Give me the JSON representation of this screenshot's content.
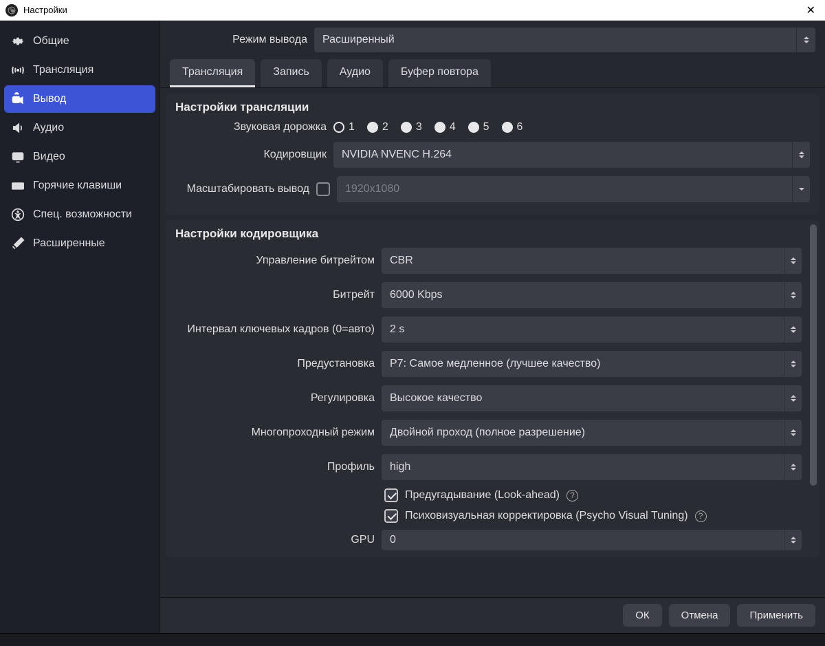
{
  "window": {
    "title": "Настройки"
  },
  "sidebar": {
    "items": [
      {
        "label": "Общие"
      },
      {
        "label": "Трансляция"
      },
      {
        "label": "Вывод"
      },
      {
        "label": "Аудио"
      },
      {
        "label": "Видео"
      },
      {
        "label": "Горячие клавиши"
      },
      {
        "label": "Спец. возможности"
      },
      {
        "label": "Расширенные"
      }
    ]
  },
  "output_mode": {
    "label": "Режим вывода",
    "value": "Расширенный"
  },
  "tabs": [
    {
      "label": "Трансляция"
    },
    {
      "label": "Запись"
    },
    {
      "label": "Аудио"
    },
    {
      "label": "Буфер повтора"
    }
  ],
  "stream": {
    "title": "Настройки трансляции",
    "audio_track_label": "Звуковая дорожка",
    "tracks": [
      "1",
      "2",
      "3",
      "4",
      "5",
      "6"
    ],
    "encoder_label": "Кодировщик",
    "encoder_value": "NVIDIA NVENC H.264",
    "rescale_label": "Масштабировать вывод",
    "rescale_value": "1920x1080"
  },
  "encoder": {
    "title": "Настройки кодировщика",
    "rate_control_label": "Управление битрейтом",
    "rate_control_value": "CBR",
    "bitrate_label": "Битрейт",
    "bitrate_value": "6000 Kbps",
    "keyint_label": "Интервал ключевых кадров (0=авто)",
    "keyint_value": "2 s",
    "preset_label": "Предустановка",
    "preset_value": "P7: Самое медленное (лучшее качество)",
    "tuning_label": "Регулировка",
    "tuning_value": "Высокое качество",
    "multipass_label": "Многопроходный режим",
    "multipass_value": "Двойной проход (полное разрешение)",
    "profile_label": "Профиль",
    "profile_value": "high",
    "lookahead_label": "Предугадывание (Look-ahead)",
    "psycho_label": "Психовизуальная корректировка (Psycho Visual Tuning)",
    "gpu_label": "GPU",
    "gpu_value": "0"
  },
  "footer": {
    "ok": "ОК",
    "cancel": "Отмена",
    "apply": "Применить"
  }
}
